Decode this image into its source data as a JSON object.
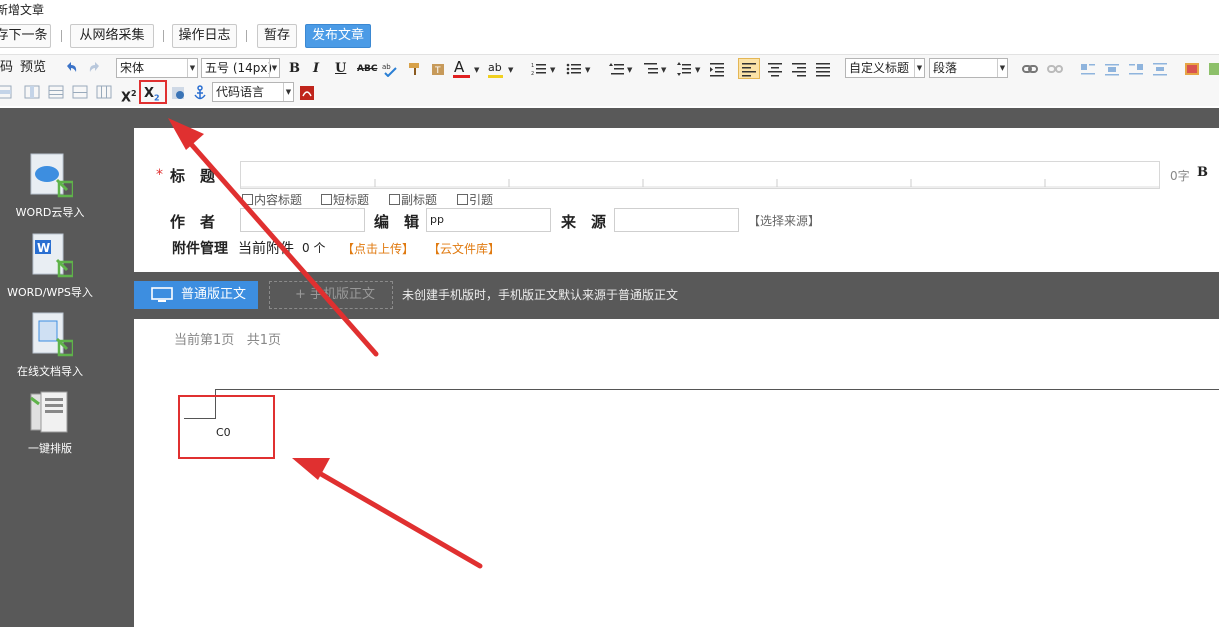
{
  "window": {
    "title": "新增文章"
  },
  "actions": {
    "next": "存下一条",
    "collect": "从网络采集",
    "log": "操作日志",
    "draft": "暂存",
    "publish": "发布文章"
  },
  "toolbar": {
    "source": "码",
    "preview": "预览",
    "font_family": "宋体",
    "font_size": "五号 (14px)",
    "custom_heading": "自定义标题",
    "paragraph": "段落",
    "code_language": "代码语言",
    "superscript_icon": "superscript-icon",
    "subscript_icon": "subscript-icon"
  },
  "sidebar": {
    "items": [
      {
        "label": "WORD云导入",
        "icon": "cloud-import-icon"
      },
      {
        "label": "WORD/WPS导入",
        "icon": "word-import-icon"
      },
      {
        "label": "在线文档导入",
        "icon": "online-doc-import-icon"
      },
      {
        "label": "一键排版",
        "icon": "auto-format-icon"
      }
    ]
  },
  "form": {
    "title_label": "标　题",
    "title_required_mark": "*",
    "title_counter": "0字",
    "title_bold": "B",
    "options": [
      "内容标题",
      "短标题",
      "副标题",
      "引题"
    ],
    "author_label": "作　者",
    "author_value": "",
    "editor_label": "编　辑",
    "editor_value": "pp",
    "source_label": "来　源",
    "source_value": "",
    "choose_source": "【选择来源】",
    "attach_label": "附件管理",
    "attach_current": "当前附件",
    "attach_count": "0 个",
    "upload_link": "【点击上传】",
    "cloud_link": "【云文件库】"
  },
  "tabs": {
    "normal": "普通版正文",
    "mobile": "+ 手机版正文",
    "note": "未创建手机版时，手机版正文默认来源于普通版正文"
  },
  "editor": {
    "current_page": "当前第1页",
    "total_pages": "共1页",
    "cell_text": "C0"
  },
  "colors": {
    "accent_blue": "#3d8ee0",
    "annotation_red": "#e03030",
    "sidebar_bg": "#595959"
  }
}
